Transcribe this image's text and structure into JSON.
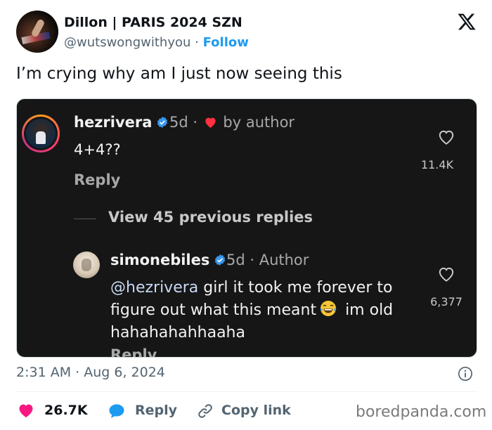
{
  "header": {
    "display_name": "Dillon | PARIS 2024 SZN",
    "handle": "@wutswongwithyou",
    "separator": "·",
    "follow_label": "Follow",
    "logo": "x-logo"
  },
  "tweet": {
    "text": "I’m crying why am I just now seeing this"
  },
  "embed": {
    "comment1": {
      "username": "hezrivera",
      "age": "5d ·",
      "by_author": "by author",
      "text": "4+4??",
      "reply_label": "Reply",
      "like_count": "11.4K"
    },
    "view_previous": "View 45 previous replies",
    "comment2": {
      "username": "simonebiles",
      "meta": "5d · Author",
      "mention": "@hezrivera",
      "text_part1": " girl it took me forever to figure out what this meant",
      "emoji": "face-with-tears-of-joy",
      "text_part2": " im old hahahahahhaaha",
      "like_count": "6,377",
      "reply_label_cut": "Reply"
    }
  },
  "footer": {
    "timestamp": "2:31 AM · Aug 6, 2024",
    "actions": {
      "like_count": "26.7K",
      "reply_label": "Reply",
      "copy_label": "Copy link"
    },
    "watermark": "boredpanda.com"
  },
  "colors": {
    "accent": "#1d9bf0",
    "heart": "#f91880",
    "embed_bg": "#161616",
    "muted": "#536471"
  }
}
